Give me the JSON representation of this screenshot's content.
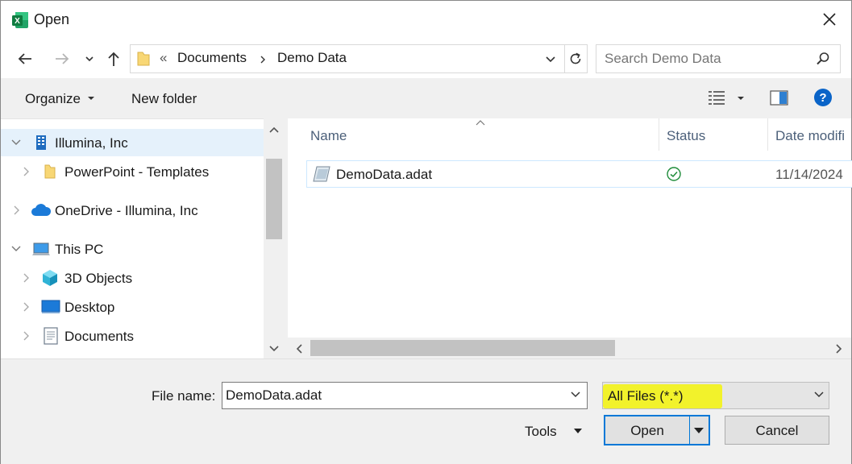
{
  "window": {
    "title": "Open"
  },
  "address": {
    "overflow": "«",
    "path": [
      "Documents",
      "Demo Data"
    ]
  },
  "search": {
    "placeholder": "Search Demo Data"
  },
  "toolbar": {
    "organize": "Organize",
    "new_folder": "New folder"
  },
  "nav": {
    "items": [
      {
        "label": "Illumina, Inc"
      },
      {
        "label": "PowerPoint - Templates"
      },
      {
        "label": "OneDrive - Illumina, Inc"
      },
      {
        "label": "This PC"
      },
      {
        "label": "3D Objects"
      },
      {
        "label": "Desktop"
      },
      {
        "label": "Documents"
      }
    ]
  },
  "columns": {
    "name": "Name",
    "status": "Status",
    "date": "Date modifi"
  },
  "files": [
    {
      "name": "DemoData.adat",
      "date": "11/14/2024"
    }
  ],
  "bottom": {
    "file_name_label": "File name:",
    "file_name_value": "DemoData.adat",
    "filter_value": "All Files (*.*)",
    "tools_label": "Tools",
    "open_label": "Open",
    "cancel_label": "Cancel"
  },
  "colors": {
    "accent": "#0078d7",
    "help": "#0a64c8",
    "highlight": "#f4f40a",
    "selection": "#e5f1fb"
  }
}
